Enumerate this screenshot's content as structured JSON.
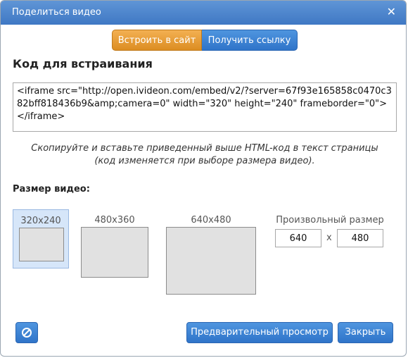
{
  "dialog": {
    "title": "Поделиться видео",
    "close_icon": "close-icon"
  },
  "tabs": [
    {
      "label": "Встроить в сайт",
      "active": true
    },
    {
      "label": "Получить ссылку",
      "active": false
    }
  ],
  "embed": {
    "heading": "Код для встраивания",
    "code": "<iframe src=\"http://open.ivideon.com/embed/v2/?server=67f93e165858c0470c382bff818436b9&amp;camera=0\" width=\"320\" height=\"240\" frameborder=\"0\"></iframe>",
    "hint_line1": "Скопируйте и вставьте приведенный выше HTML-код в текст страницы",
    "hint_line2": "(код изменяется при выборе размера видео)."
  },
  "size": {
    "label": "Размер видео:",
    "options": [
      {
        "label": "320x240",
        "selected": true
      },
      {
        "label": "480x360",
        "selected": false
      },
      {
        "label": "640x480",
        "selected": false
      }
    ],
    "custom_label": "Произвольный размер",
    "custom_width": "640",
    "custom_height": "480",
    "separator": "x"
  },
  "footer": {
    "block_icon": "block-icon",
    "preview_label": "Предварительный просмотр",
    "close_label": "Закрыть"
  },
  "colors": {
    "title_bar": "#4a86cf",
    "active_tab": "#e89e38",
    "button_blue": "#3d82d3",
    "selected_size_bg": "#d6e6f9"
  }
}
